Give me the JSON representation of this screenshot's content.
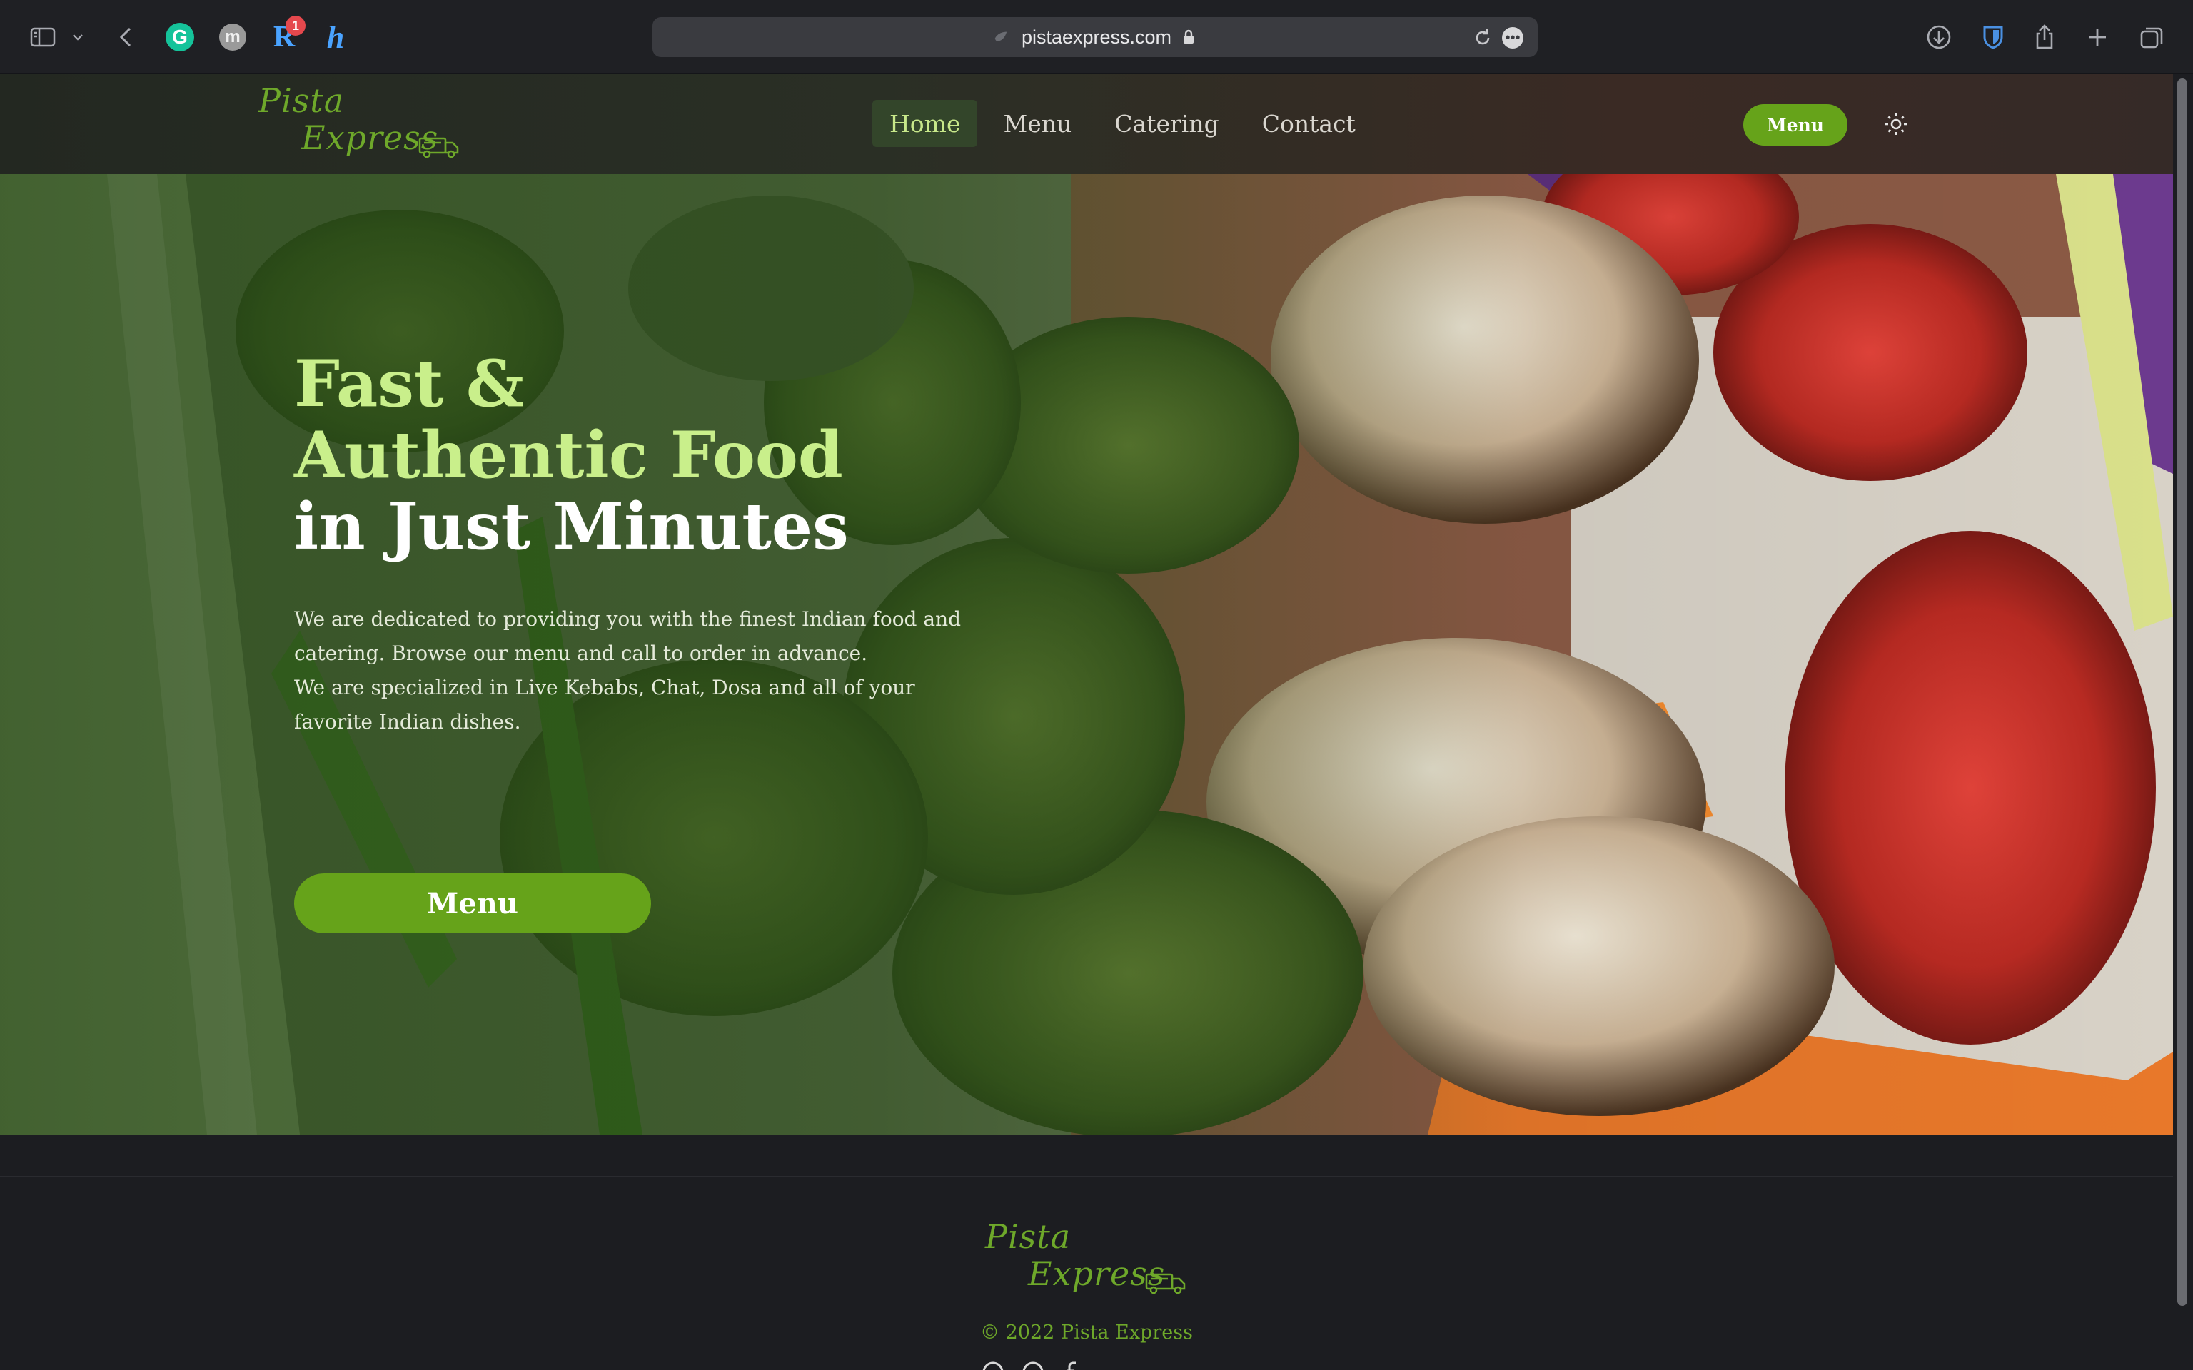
{
  "browser": {
    "url": "pistaexpress.com",
    "extensions": {
      "grammarly": "G",
      "m": "m",
      "r": "R",
      "r_badge": "1",
      "h": "h"
    }
  },
  "site": {
    "logo": {
      "line1": "Pista",
      "line2": "Express"
    },
    "nav": {
      "items": [
        {
          "label": "Home",
          "active": true
        },
        {
          "label": "Menu",
          "active": false
        },
        {
          "label": "Catering",
          "active": false
        },
        {
          "label": "Contact",
          "active": false
        }
      ],
      "menu_button": "Menu"
    },
    "hero": {
      "title_line1": "Fast &",
      "title_line2": "Authentic Food",
      "title_line3": "in Just Minutes",
      "desc_p1": "We are dedicated to providing you with the finest Indian food and catering. Browse our menu and call to order in advance.",
      "desc_p2": "We are specialized in Live Kebabs, Chat, Dosa and all of your favorite Indian dishes.",
      "cta": "Menu"
    },
    "footer": {
      "copyright": "© 2022 Pista Express"
    }
  },
  "colors": {
    "accent": "#66a31a",
    "title_green": "#c9ef8b",
    "logo_green": "#6ea82a",
    "bg": "#1c1d21"
  }
}
